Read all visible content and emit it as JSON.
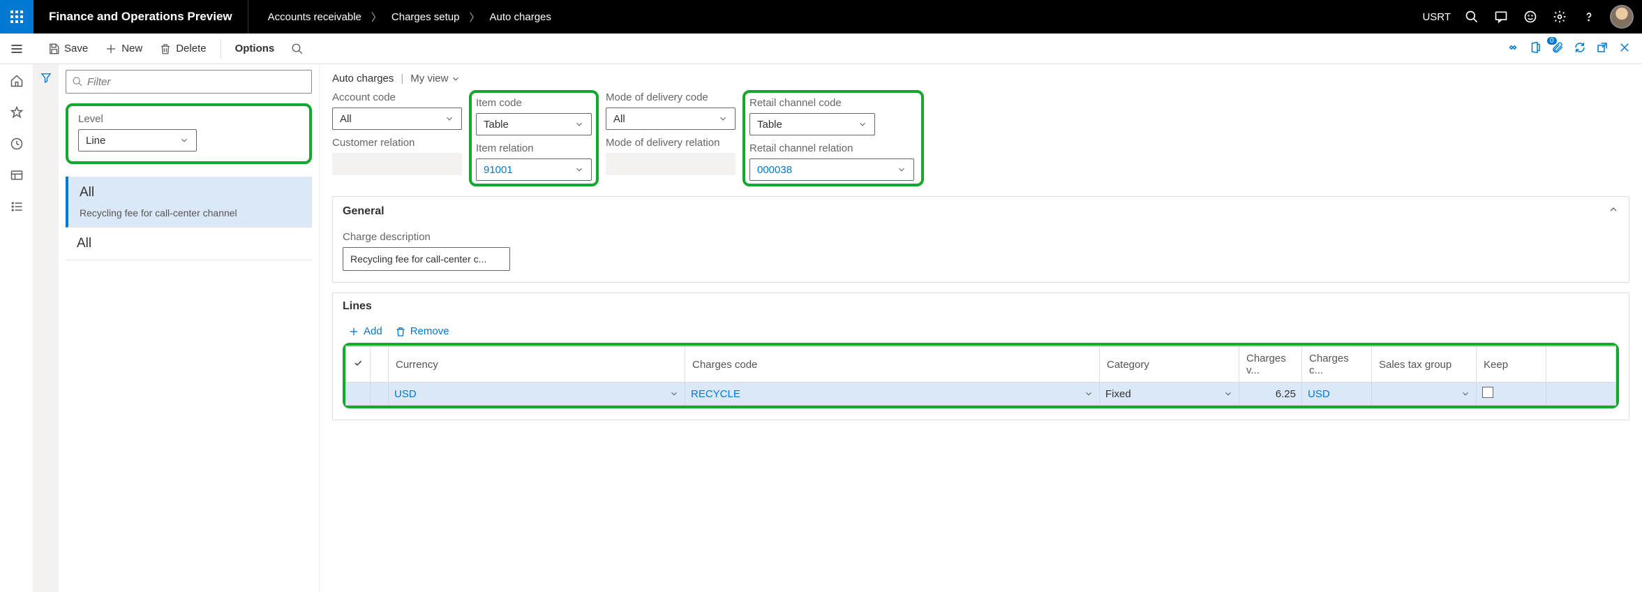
{
  "titlebar": {
    "app_title": "Finance and Operations Preview",
    "breadcrumb": [
      "Accounts receivable",
      "Charges setup",
      "Auto charges"
    ],
    "company": "USRT"
  },
  "commandbar": {
    "save": "Save",
    "new": "New",
    "delete": "Delete",
    "options": "Options",
    "attachments_count": "0"
  },
  "nav": {
    "filter_placeholder": "Filter",
    "level_label": "Level",
    "level_value": "Line",
    "items": [
      {
        "title": "All",
        "subtitle": "Recycling fee for call-center channel",
        "selected": true
      },
      {
        "title": "All",
        "subtitle": "",
        "selected": false
      }
    ]
  },
  "page": {
    "title": "Auto charges",
    "view_label": "My view",
    "fields": {
      "account_code": {
        "label": "Account code",
        "value": "All"
      },
      "item_code": {
        "label": "Item code",
        "value": "Table"
      },
      "mode_delivery_code": {
        "label": "Mode of delivery code",
        "value": "All"
      },
      "retail_channel_code": {
        "label": "Retail channel code",
        "value": "Table"
      },
      "customer_relation": {
        "label": "Customer relation",
        "value": ""
      },
      "item_relation": {
        "label": "Item relation",
        "value": "91001"
      },
      "mode_delivery_relation": {
        "label": "Mode of delivery relation",
        "value": ""
      },
      "retail_channel_relation": {
        "label": "Retail channel relation",
        "value": "000038"
      }
    },
    "general": {
      "heading": "General",
      "charge_description_label": "Charge description",
      "charge_description_value": "Recycling fee for call-center c..."
    },
    "lines": {
      "heading": "Lines",
      "add": "Add",
      "remove": "Remove",
      "columns": {
        "currency": "Currency",
        "charges_code": "Charges code",
        "category": "Category",
        "charges_value": "Charges v...",
        "charges_c": "Charges c...",
        "sales_tax_group": "Sales tax group",
        "keep": "Keep"
      },
      "rows": [
        {
          "currency": "USD",
          "charges_code": "RECYCLE",
          "category": "Fixed",
          "charges_value": "6.25",
          "charges_c": "USD",
          "sales_tax_group": "",
          "keep": false
        }
      ]
    }
  }
}
